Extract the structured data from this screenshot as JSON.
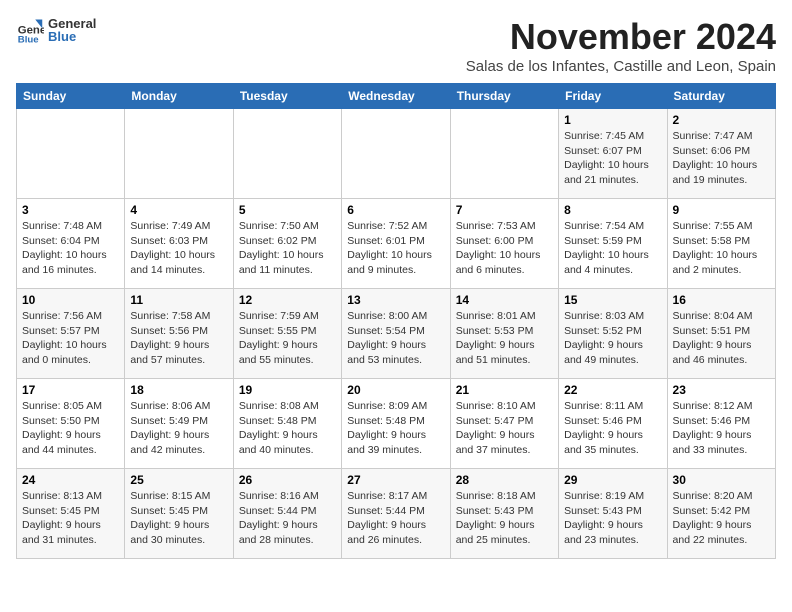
{
  "logo": {
    "general": "General",
    "blue": "Blue"
  },
  "title": "November 2024",
  "subtitle": "Salas de los Infantes, Castille and Leon, Spain",
  "weekdays": [
    "Sunday",
    "Monday",
    "Tuesday",
    "Wednesday",
    "Thursday",
    "Friday",
    "Saturday"
  ],
  "weeks": [
    [
      {
        "day": "",
        "info": ""
      },
      {
        "day": "",
        "info": ""
      },
      {
        "day": "",
        "info": ""
      },
      {
        "day": "",
        "info": ""
      },
      {
        "day": "",
        "info": ""
      },
      {
        "day": "1",
        "info": "Sunrise: 7:45 AM\nSunset: 6:07 PM\nDaylight: 10 hours\nand 21 minutes."
      },
      {
        "day": "2",
        "info": "Sunrise: 7:47 AM\nSunset: 6:06 PM\nDaylight: 10 hours\nand 19 minutes."
      }
    ],
    [
      {
        "day": "3",
        "info": "Sunrise: 7:48 AM\nSunset: 6:04 PM\nDaylight: 10 hours\nand 16 minutes."
      },
      {
        "day": "4",
        "info": "Sunrise: 7:49 AM\nSunset: 6:03 PM\nDaylight: 10 hours\nand 14 minutes."
      },
      {
        "day": "5",
        "info": "Sunrise: 7:50 AM\nSunset: 6:02 PM\nDaylight: 10 hours\nand 11 minutes."
      },
      {
        "day": "6",
        "info": "Sunrise: 7:52 AM\nSunset: 6:01 PM\nDaylight: 10 hours\nand 9 minutes."
      },
      {
        "day": "7",
        "info": "Sunrise: 7:53 AM\nSunset: 6:00 PM\nDaylight: 10 hours\nand 6 minutes."
      },
      {
        "day": "8",
        "info": "Sunrise: 7:54 AM\nSunset: 5:59 PM\nDaylight: 10 hours\nand 4 minutes."
      },
      {
        "day": "9",
        "info": "Sunrise: 7:55 AM\nSunset: 5:58 PM\nDaylight: 10 hours\nand 2 minutes."
      }
    ],
    [
      {
        "day": "10",
        "info": "Sunrise: 7:56 AM\nSunset: 5:57 PM\nDaylight: 10 hours\nand 0 minutes."
      },
      {
        "day": "11",
        "info": "Sunrise: 7:58 AM\nSunset: 5:56 PM\nDaylight: 9 hours\nand 57 minutes."
      },
      {
        "day": "12",
        "info": "Sunrise: 7:59 AM\nSunset: 5:55 PM\nDaylight: 9 hours\nand 55 minutes."
      },
      {
        "day": "13",
        "info": "Sunrise: 8:00 AM\nSunset: 5:54 PM\nDaylight: 9 hours\nand 53 minutes."
      },
      {
        "day": "14",
        "info": "Sunrise: 8:01 AM\nSunset: 5:53 PM\nDaylight: 9 hours\nand 51 minutes."
      },
      {
        "day": "15",
        "info": "Sunrise: 8:03 AM\nSunset: 5:52 PM\nDaylight: 9 hours\nand 49 minutes."
      },
      {
        "day": "16",
        "info": "Sunrise: 8:04 AM\nSunset: 5:51 PM\nDaylight: 9 hours\nand 46 minutes."
      }
    ],
    [
      {
        "day": "17",
        "info": "Sunrise: 8:05 AM\nSunset: 5:50 PM\nDaylight: 9 hours\nand 44 minutes."
      },
      {
        "day": "18",
        "info": "Sunrise: 8:06 AM\nSunset: 5:49 PM\nDaylight: 9 hours\nand 42 minutes."
      },
      {
        "day": "19",
        "info": "Sunrise: 8:08 AM\nSunset: 5:48 PM\nDaylight: 9 hours\nand 40 minutes."
      },
      {
        "day": "20",
        "info": "Sunrise: 8:09 AM\nSunset: 5:48 PM\nDaylight: 9 hours\nand 39 minutes."
      },
      {
        "day": "21",
        "info": "Sunrise: 8:10 AM\nSunset: 5:47 PM\nDaylight: 9 hours\nand 37 minutes."
      },
      {
        "day": "22",
        "info": "Sunrise: 8:11 AM\nSunset: 5:46 PM\nDaylight: 9 hours\nand 35 minutes."
      },
      {
        "day": "23",
        "info": "Sunrise: 8:12 AM\nSunset: 5:46 PM\nDaylight: 9 hours\nand 33 minutes."
      }
    ],
    [
      {
        "day": "24",
        "info": "Sunrise: 8:13 AM\nSunset: 5:45 PM\nDaylight: 9 hours\nand 31 minutes."
      },
      {
        "day": "25",
        "info": "Sunrise: 8:15 AM\nSunset: 5:45 PM\nDaylight: 9 hours\nand 30 minutes."
      },
      {
        "day": "26",
        "info": "Sunrise: 8:16 AM\nSunset: 5:44 PM\nDaylight: 9 hours\nand 28 minutes."
      },
      {
        "day": "27",
        "info": "Sunrise: 8:17 AM\nSunset: 5:44 PM\nDaylight: 9 hours\nand 26 minutes."
      },
      {
        "day": "28",
        "info": "Sunrise: 8:18 AM\nSunset: 5:43 PM\nDaylight: 9 hours\nand 25 minutes."
      },
      {
        "day": "29",
        "info": "Sunrise: 8:19 AM\nSunset: 5:43 PM\nDaylight: 9 hours\nand 23 minutes."
      },
      {
        "day": "30",
        "info": "Sunrise: 8:20 AM\nSunset: 5:42 PM\nDaylight: 9 hours\nand 22 minutes."
      }
    ]
  ]
}
